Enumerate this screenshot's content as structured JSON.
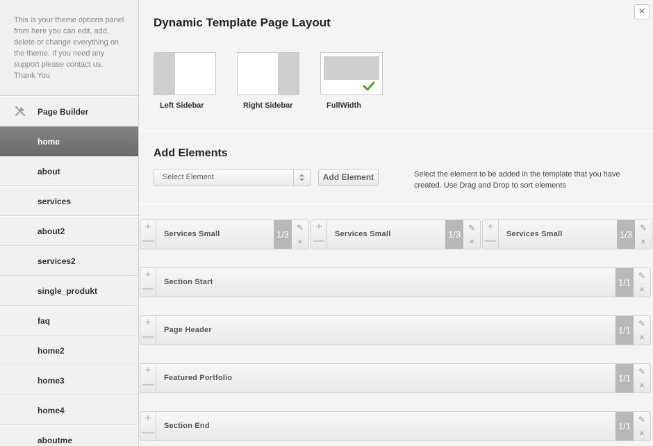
{
  "sidebar": {
    "intro": "This is your theme options panel from here you can edit, add, delete or change everything on the theme. If you need any support please contact us. Thank You",
    "builder_label": "Page Builder",
    "items": [
      {
        "label": "home",
        "active": true
      },
      {
        "label": "about"
      },
      {
        "label": "services"
      },
      {
        "label": "about2"
      },
      {
        "label": "services2"
      },
      {
        "label": "single_produkt"
      },
      {
        "label": "faq"
      },
      {
        "label": "home2"
      },
      {
        "label": "home3"
      },
      {
        "label": "home4"
      },
      {
        "label": "aboutme"
      }
    ]
  },
  "main": {
    "close_label": "×",
    "layout_title": "Dynamic Template Page Layout",
    "layouts": [
      {
        "label": "Left Sidebar"
      },
      {
        "label": "Right Sidebar"
      },
      {
        "label": "FullWidth",
        "selected": true
      }
    ],
    "add_title": "Add Elements",
    "select_placeholder": "Select Element",
    "add_button": "Add Element",
    "help_text": "Select the element to be added in the template that you have created. Use Drag and Drop to sort elements",
    "elements": [
      {
        "title": "Services Small",
        "size": "1/3"
      },
      {
        "title": "Services Small",
        "size": "1/3"
      },
      {
        "title": "Services Small",
        "size": "1/3"
      },
      {
        "title": "Section Start",
        "size": "1/1"
      },
      {
        "title": "Page Header",
        "size": "1/1"
      },
      {
        "title": "Featured Portfolio",
        "size": "1/1"
      },
      {
        "title": "Section End",
        "size": "1/1"
      }
    ]
  },
  "icons": {
    "plus": "+",
    "minus": "—",
    "edit": "✎",
    "delete": "×"
  },
  "colors": {
    "active_item": "#6f6f6f",
    "size_badge": "#b8b8b8",
    "check": "#5a9e2f"
  }
}
